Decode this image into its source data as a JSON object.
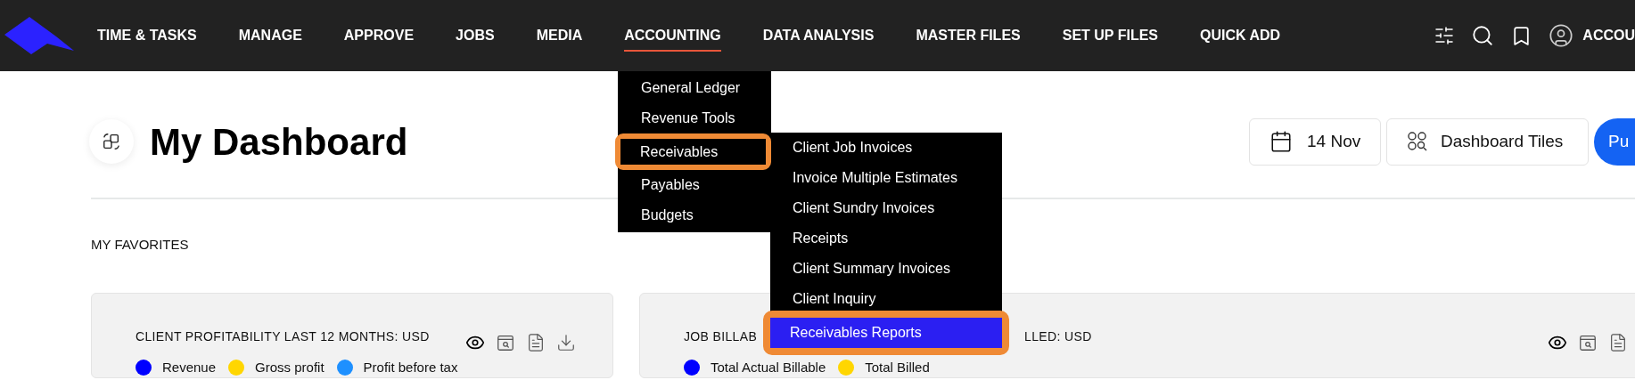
{
  "nav": {
    "items": [
      {
        "label": "TIME & TASKS",
        "selected": false
      },
      {
        "label": "MANAGE",
        "selected": false
      },
      {
        "label": "APPROVE",
        "selected": false
      },
      {
        "label": "JOBS",
        "selected": false
      },
      {
        "label": "MEDIA",
        "selected": false
      },
      {
        "label": "ACCOUNTING",
        "selected": true
      },
      {
        "label": "DATA ANALYSIS",
        "selected": false
      },
      {
        "label": "MASTER FILES",
        "selected": false
      },
      {
        "label": "SET UP FILES",
        "selected": false
      },
      {
        "label": "QUICK ADD",
        "selected": false
      }
    ],
    "account_label": "ACCOU"
  },
  "menu": {
    "items": [
      {
        "label": "General Ledger",
        "highlighted": false
      },
      {
        "label": "Revenue Tools",
        "highlighted": false
      },
      {
        "label": "Receivables",
        "highlighted": true
      },
      {
        "label": "Payables",
        "highlighted": false
      },
      {
        "label": "Budgets",
        "highlighted": false
      }
    ]
  },
  "submenu": {
    "items": [
      {
        "label": "Client Job Invoices",
        "selected": false,
        "highlighted": false
      },
      {
        "label": "Invoice Multiple Estimates",
        "selected": false,
        "highlighted": false
      },
      {
        "label": "Client Sundry Invoices",
        "selected": false,
        "highlighted": false
      },
      {
        "label": "Receipts",
        "selected": false,
        "highlighted": false
      },
      {
        "label": "Client Summary Invoices",
        "selected": false,
        "highlighted": false
      },
      {
        "label": "Client Inquiry",
        "selected": false,
        "highlighted": false
      },
      {
        "label": "Receivables Reports",
        "selected": true,
        "highlighted": true
      }
    ]
  },
  "header": {
    "title": "My Dashboard",
    "date": "14 Nov",
    "tiles_button": "Dashboard Tiles",
    "primary_button": "Pu"
  },
  "favorites_label": "MY FAVORITES",
  "cards": [
    {
      "title_parts": [
        "CLIENT PROFITABILITY LAST 12 MONTHS: USD"
      ],
      "legend": [
        {
          "label": "Revenue",
          "color": "#0000ff"
        },
        {
          "label": "Gross profit",
          "color": "#ffd600"
        },
        {
          "label": "Profit before tax",
          "color": "#1e90ff"
        }
      ]
    },
    {
      "title_parts": [
        "JOB BILLAB",
        "LLED: USD"
      ],
      "legend": [
        {
          "label": "Total Actual Billable",
          "color": "#0000ff"
        },
        {
          "label": "Total Billed",
          "color": "#ffd600"
        }
      ]
    }
  ]
}
